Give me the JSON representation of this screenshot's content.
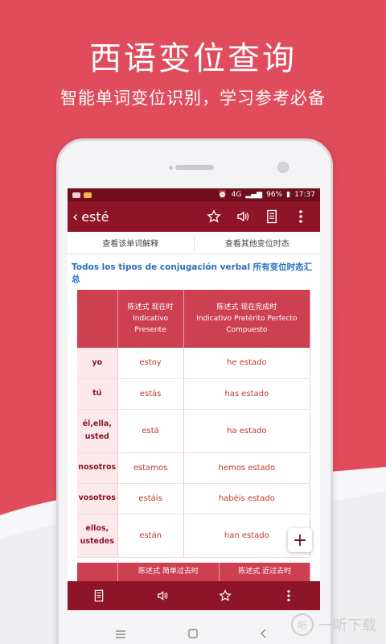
{
  "promo": {
    "headline": "西语变位查询",
    "subline": "智能单词变位识别，学习参考必备"
  },
  "statusbar": {
    "battery": "96%",
    "time": "17:37",
    "network": "4G"
  },
  "appbar": {
    "back_glyph": "‹",
    "title": "esté"
  },
  "subtabs": {
    "word_explanation": "查看该单词解释",
    "other_tenses": "查看其他变位时态"
  },
  "section": {
    "title_es": "Todos los tipos de conjugación verbal",
    "title_zh": "所有变位时态汇总"
  },
  "table1": {
    "headers": [
      {
        "zh": "陈述式 现在时",
        "es": "Indicativo Presente"
      },
      {
        "zh": "陈述式 现在完成时",
        "es": "Indicativo Pretérito Perfecto Compuesto"
      }
    ],
    "rows": [
      {
        "person": "yo",
        "c1": "estoy",
        "c2": "he estado"
      },
      {
        "person": "tú",
        "c1": "estás",
        "c2": "has estado"
      },
      {
        "person": "él,ella, usted",
        "c1": "está",
        "c2": "ha estado"
      },
      {
        "person": "nosotros",
        "c1": "estamos",
        "c2": "hemos estado"
      },
      {
        "person": "vosotros",
        "c1": "estáis",
        "c2": "habéis estado"
      },
      {
        "person": "ellos, ustedes",
        "c1": "están",
        "c2": "han estado"
      }
    ]
  },
  "table2": {
    "headers": [
      {
        "zh": "陈述式 简单过去时"
      },
      {
        "zh": "陈述式 近过去时"
      }
    ]
  },
  "fab_glyph": "+",
  "watermark": {
    "logo_text": "听",
    "text": "一听下载"
  },
  "colors": {
    "brand": "#8e1428",
    "accent": "#e14b5b",
    "link": "#2b6fbf"
  }
}
